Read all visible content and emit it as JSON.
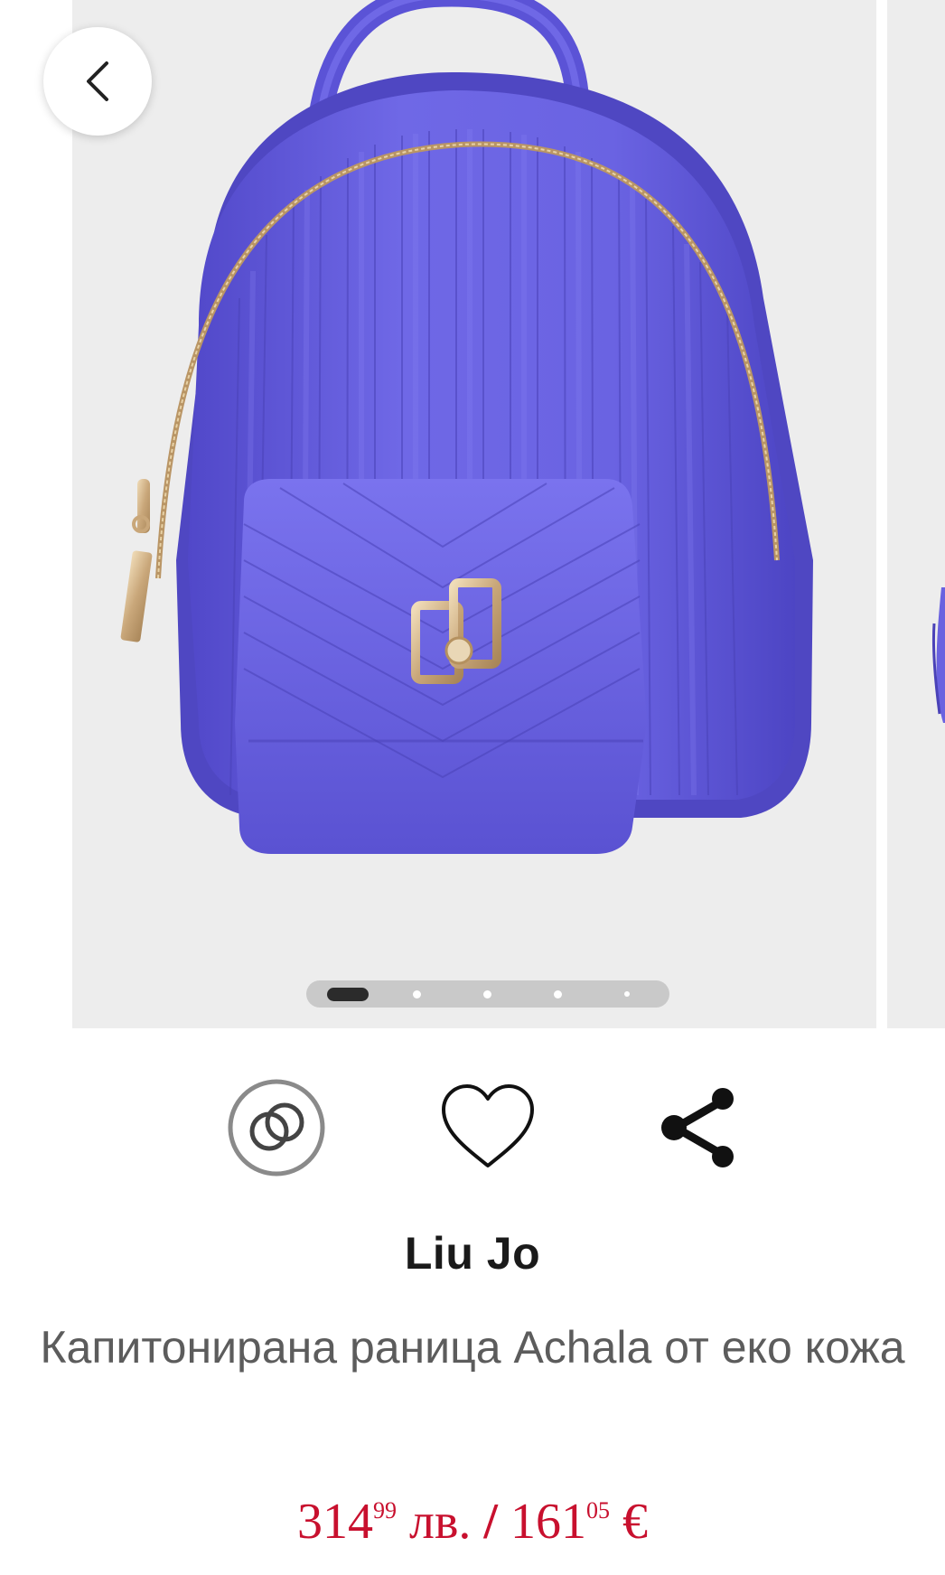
{
  "gallery": {
    "active_index": 0,
    "slides_count": 5,
    "back_icon": "chevron-left-icon"
  },
  "actions": {
    "compare_icon": "compare-rings-icon",
    "favorite_icon": "heart-outline-icon",
    "share_icon": "share-icon"
  },
  "product": {
    "brand": "Liu Jo",
    "title": "Капитонирана раница Achala от еко кожа",
    "price": {
      "bgn_whole": "314",
      "bgn_cents": "99",
      "bgn_currency": "лв.",
      "separator": "/",
      "eur_whole": "161",
      "eur_cents": "05",
      "eur_currency": "€"
    }
  },
  "colors": {
    "price_red": "#c8102e",
    "bag_purple": "#6a62e0",
    "image_bg": "#ededed"
  }
}
